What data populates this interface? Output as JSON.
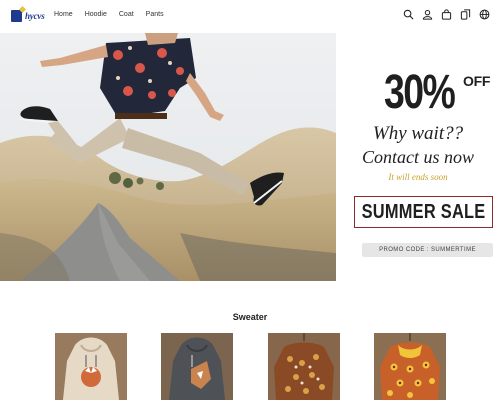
{
  "header": {
    "logo_text": "hycvs",
    "nav": [
      "Home",
      "Hoodie",
      "Coat",
      "Pants"
    ],
    "icons": [
      "search-icon",
      "account-icon",
      "cart-icon",
      "compare-icon",
      "language-icon"
    ]
  },
  "promo": {
    "percent": "30%",
    "off": "OFF",
    "line1": "Why wait??",
    "line2": "Contact us now",
    "line3": "It will ends soon",
    "banner": "SUMMER SALE",
    "code": "PROMO CODE : SUMMERTIME"
  },
  "section": {
    "title": "Sweater",
    "products": [
      {
        "name": "fox-print-hoodie",
        "bg": "#9c8060"
      },
      {
        "name": "grey-fox-hoodie",
        "bg": "#6f5a45"
      },
      {
        "name": "brown-print-sweater",
        "bg": "#7a5a42"
      },
      {
        "name": "yellow-floral-sweater",
        "bg": "#7f6346"
      }
    ]
  },
  "colors": {
    "accent": "#1d3c8f",
    "gold": "#c8a22e",
    "banner_border": "#8b2a2a"
  }
}
